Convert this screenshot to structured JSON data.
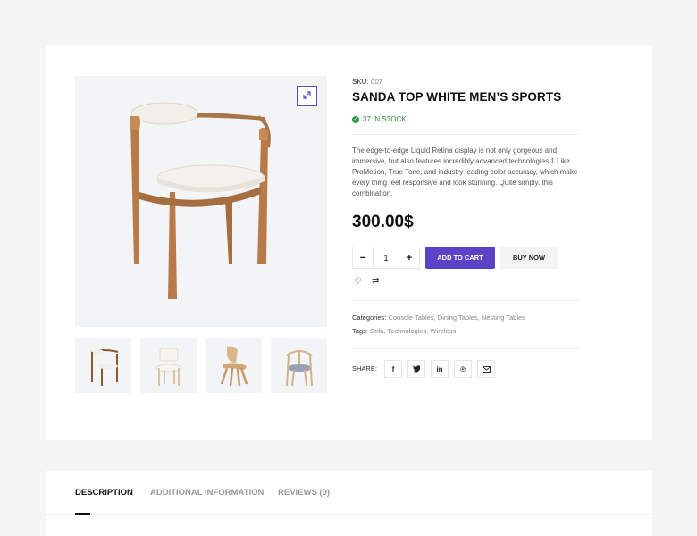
{
  "product": {
    "sku_label": "SKU:",
    "sku_value": "007",
    "title": "SANDA TOP WHITE MEN’S SPORTS",
    "stock": "37 IN STOCK",
    "description": "The edge-to-edge Liquid Retina display is not only gorgeous and immersive, but also features incredibly advanced technologies.1 Like ProMotion, True Tone, and industry leading color accuracy, which make every thing feel responsive and look stunning. Quite simply, this combination.",
    "price": "300.00$"
  },
  "cart": {
    "minus": "−",
    "quantity": "1",
    "plus": "+",
    "add_to_cart": "ADD TO CART",
    "buy_now": "BUY NOW"
  },
  "meta": {
    "categories_label": "Categories:",
    "categories": [
      "Console Tables",
      "Dining Tables",
      "Nesting Tables"
    ],
    "tags_label": "Tags:",
    "tags": [
      "Sofa",
      "Technologies",
      "Wireless"
    ]
  },
  "share": {
    "label": "SHARE:",
    "icons": [
      "facebook-icon",
      "twitter-icon",
      "linkedin-icon",
      "pinterest-icon",
      "email-icon"
    ]
  },
  "tabs": [
    {
      "label": "DESCRIPTION"
    },
    {
      "label": "ADDITIONAL INFORMATION"
    },
    {
      "label": "REVIEWS (0)"
    }
  ],
  "colors": {
    "accent": "#5b43c8",
    "stock": "#2c8a3c",
    "background": "#f5f5f5"
  }
}
